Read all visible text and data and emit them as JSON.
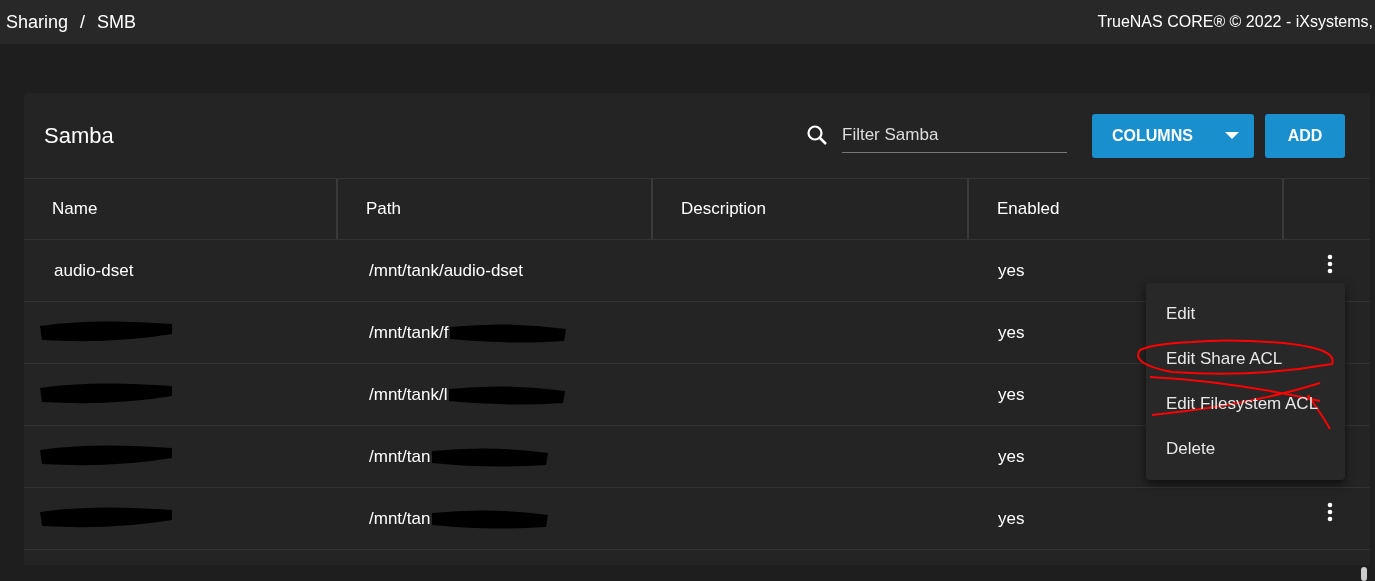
{
  "breadcrumb": [
    "Sharing",
    "SMB"
  ],
  "breadcrumb_separator": "/",
  "copyright": "TrueNAS CORE® © 2022 - iXsystems,",
  "card": {
    "title": "Samba",
    "filter": {
      "placeholder": "Filter Samba"
    },
    "buttons": [
      {
        "label": "COLUMNS",
        "kind": "dropdown"
      },
      {
        "label": "ADD",
        "kind": "plain"
      }
    ]
  },
  "table": {
    "columns": [
      "Name",
      "Path",
      "Description",
      "Enabled"
    ],
    "rows": [
      {
        "name": "audio-dset",
        "path": "/mnt/tank/audio-dset",
        "enabled": "yes",
        "redacted": false,
        "menu_button": true
      },
      {
        "path": "/mnt/tank/f",
        "enabled": "yes",
        "redacted": true,
        "menu_button": false
      },
      {
        "path": "/mnt/tank/l",
        "enabled": "yes",
        "redacted": true,
        "menu_button": false
      },
      {
        "path": "/mnt/tan",
        "enabled": "yes",
        "redacted": true,
        "menu_button": false
      },
      {
        "path": "/mnt/tan",
        "enabled": "yes",
        "redacted": true,
        "menu_button": true
      }
    ]
  },
  "menu": {
    "items": [
      {
        "label": "Edit",
        "circled": false,
        "struck_through": false
      },
      {
        "label": "Edit Share ACL",
        "circled": true,
        "struck_through": false
      },
      {
        "label": "Edit Filesystem ACL",
        "circled": false,
        "struck_through": true
      },
      {
        "label": "Delete",
        "circled": false,
        "struck_through": false
      }
    ]
  }
}
